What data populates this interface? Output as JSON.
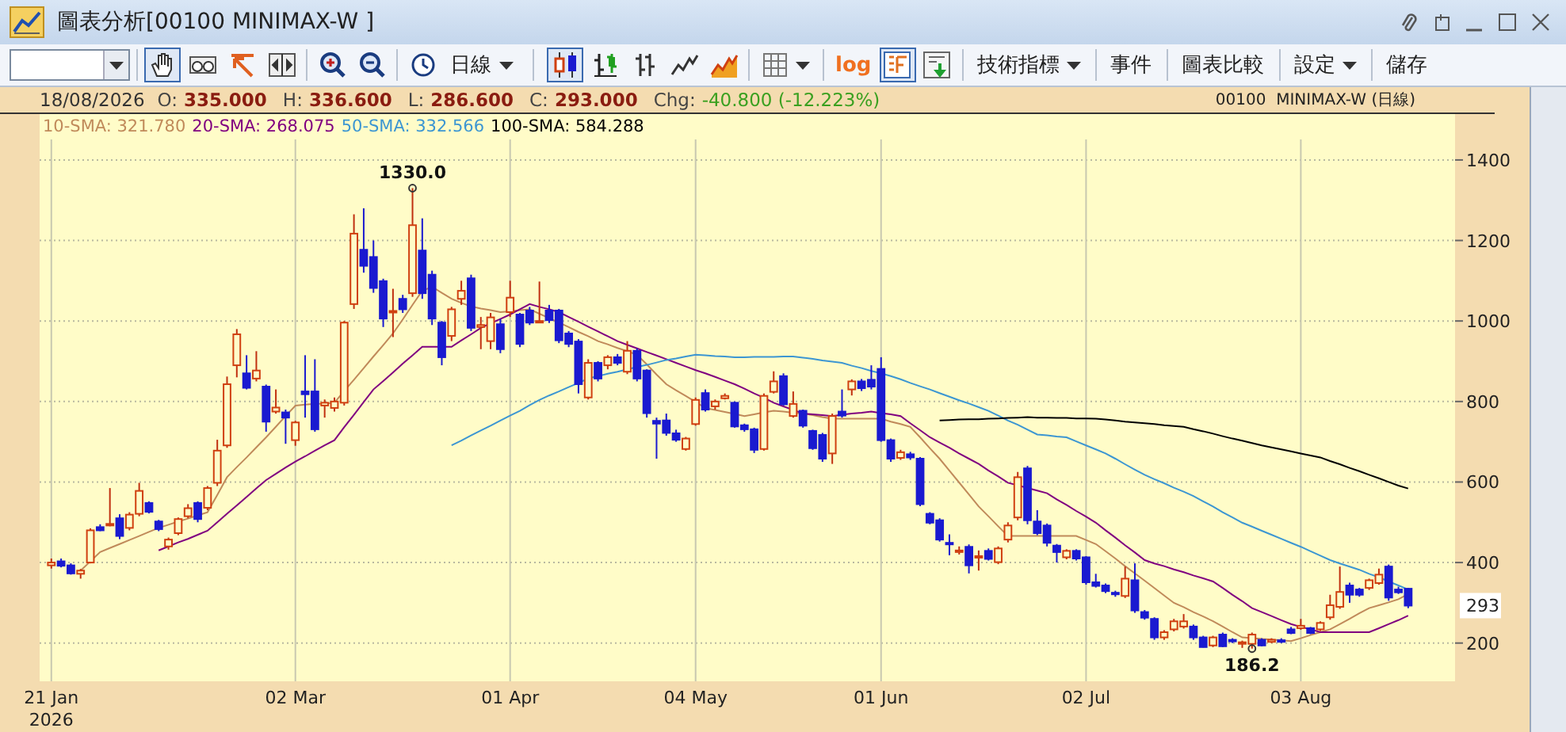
{
  "window": {
    "title": "圖表分析[00100 MINIMAX-W ]"
  },
  "toolbar": {
    "interval": "日線",
    "chart_types": [
      {
        "selected": true
      },
      {
        "selected": false
      },
      {
        "selected": false
      },
      {
        "selected": false
      },
      {
        "selected": false
      }
    ],
    "log": {
      "label": "log",
      "selected": false
    },
    "view_toggle": {
      "selected": true
    },
    "menus": [
      {
        "label": "技術指標",
        "dropdown": true
      },
      {
        "label": "事件",
        "dropdown": false
      },
      {
        "label": "圖表比較",
        "dropdown": false
      },
      {
        "label": "設定",
        "dropdown": true
      },
      {
        "label": "儲存",
        "dropdown": false
      }
    ]
  },
  "quote": {
    "date": "18/08/2026",
    "fields": [
      {
        "label": "O:",
        "value": "335.000"
      },
      {
        "label": "H:",
        "value": "336.600"
      },
      {
        "label": "L:",
        "value": "286.600"
      },
      {
        "label": "C:",
        "value": "293.000"
      }
    ],
    "change_label": "Chg:",
    "change": "-40.800 (-12.223%)",
    "instrument": "00100  MINIMAX-W (日線)"
  },
  "legend_separator": ":",
  "legend": [
    "321.780",
    "268.075",
    "332.566",
    "584.288"
  ],
  "chart": {
    "year_label": "2026",
    "last_price": "293",
    "chart_data": {
      "type": "candlestick",
      "grid": true,
      "categories": [
        "21 Jan",
        null,
        null,
        null,
        null,
        null,
        null,
        null,
        null,
        null,
        null,
        null,
        null,
        null,
        null,
        null,
        null,
        null,
        null,
        null,
        null,
        null,
        null,
        null,
        null,
        "02 Mar",
        null,
        null,
        null,
        null,
        null,
        null,
        null,
        null,
        null,
        null,
        null,
        null,
        null,
        null,
        null,
        null,
        null,
        null,
        null,
        null,
        null,
        "01 Apr",
        null,
        null,
        null,
        null,
        null,
        null,
        null,
        null,
        null,
        null,
        null,
        null,
        null,
        null,
        null,
        null,
        null,
        null,
        "04 May",
        null,
        null,
        null,
        null,
        null,
        null,
        null,
        null,
        null,
        null,
        null,
        null,
        null,
        null,
        null,
        null,
        null,
        null,
        "01 Jun",
        null,
        null,
        null,
        null,
        null,
        null,
        null,
        null,
        null,
        null,
        null,
        null,
        null,
        null,
        null,
        null,
        null,
        null,
        null,
        null,
        "02 Jul",
        null,
        null,
        null,
        null,
        null,
        null,
        null,
        null,
        null,
        null,
        null,
        null,
        null,
        null,
        null,
        null,
        null,
        null,
        null,
        null,
        null,
        "03 Aug",
        null,
        null,
        null,
        null,
        null,
        null,
        null,
        null,
        null,
        null,
        null
      ],
      "ylim": [
        105,
        1451
      ],
      "yticks": [
        200,
        400,
        600,
        800,
        1000,
        1200,
        1400
      ],
      "annotations": [
        {
          "y": 1330,
          "text": "1330.0"
        },
        {
          "y": 186.2,
          "text": "186.2"
        }
      ],
      "ohlc": [
        [
          393,
          410,
          385,
          400
        ],
        [
          403,
          410,
          388,
          392
        ],
        [
          393,
          398,
          370,
          373
        ],
        [
          372,
          384,
          360,
          380
        ],
        [
          400,
          485,
          398,
          480
        ],
        [
          488,
          495,
          478,
          480
        ],
        [
          495,
          585,
          490,
          496
        ],
        [
          510,
          520,
          458,
          466
        ],
        [
          486,
          525,
          480,
          519
        ],
        [
          521,
          598,
          515,
          578
        ],
        [
          548,
          552,
          522,
          526
        ],
        [
          502,
          506,
          478,
          483
        ],
        [
          440,
          462,
          432,
          457
        ],
        [
          473,
          512,
          468,
          508
        ],
        [
          515,
          545,
          510,
          535
        ],
        [
          548,
          552,
          500,
          508
        ],
        [
          536,
          590,
          530,
          585
        ],
        [
          598,
          705,
          590,
          678
        ],
        [
          691,
          862,
          685,
          843
        ],
        [
          890,
          980,
          860,
          967
        ],
        [
          870,
          915,
          830,
          834
        ],
        [
          857,
          925,
          850,
          877
        ],
        [
          837,
          842,
          725,
          750
        ],
        [
          775,
          830,
          770,
          785
        ],
        [
          773,
          780,
          695,
          760
        ],
        [
          704,
          752,
          690,
          748
        ],
        [
          825,
          915,
          760,
          818
        ],
        [
          825,
          905,
          725,
          731
        ],
        [
          790,
          805,
          760,
          797
        ],
        [
          784,
          810,
          775,
          800
        ],
        [
          797,
          1000,
          790,
          996
        ],
        [
          1042,
          1265,
          1030,
          1217
        ],
        [
          1177,
          1280,
          1120,
          1137
        ],
        [
          1159,
          1200,
          1070,
          1082
        ],
        [
          1099,
          1105,
          985,
          1006
        ],
        [
          1025,
          1080,
          960,
          1025
        ],
        [
          1055,
          1065,
          1020,
          1029
        ],
        [
          1069,
          1330,
          1060,
          1238
        ],
        [
          1175,
          1255,
          1055,
          1069
        ],
        [
          1115,
          1125,
          990,
          1006
        ],
        [
          996,
          1000,
          890,
          910
        ],
        [
          963,
          1035,
          950,
          1029
        ],
        [
          1055,
          1100,
          1040,
          1075
        ],
        [
          1106,
          1115,
          975,
          983
        ],
        [
          985,
          1010,
          930,
          990
        ],
        [
          950,
          1020,
          930,
          1009
        ],
        [
          992,
          1005,
          920,
          930
        ],
        [
          1022,
          1100,
          1010,
          1058
        ],
        [
          1016,
          1020,
          935,
          943
        ],
        [
          1026,
          1035,
          990,
          996
        ],
        [
          1000,
          1098,
          995,
          1000
        ],
        [
          1026,
          1040,
          995,
          1002
        ],
        [
          1026,
          1030,
          945,
          952
        ],
        [
          969,
          975,
          935,
          943
        ],
        [
          949,
          955,
          820,
          843
        ],
        [
          810,
          905,
          805,
          896
        ],
        [
          896,
          900,
          850,
          857
        ],
        [
          890,
          915,
          880,
          910
        ],
        [
          910,
          918,
          890,
          896
        ],
        [
          874,
          950,
          868,
          926
        ],
        [
          926,
          932,
          850,
          857
        ],
        [
          877,
          880,
          760,
          771
        ],
        [
          752,
          760,
          658,
          745
        ],
        [
          753,
          770,
          715,
          722
        ],
        [
          721,
          730,
          700,
          705
        ],
        [
          682,
          712,
          678,
          708
        ],
        [
          744,
          810,
          740,
          804
        ],
        [
          821,
          830,
          775,
          780
        ],
        [
          788,
          805,
          780,
          800
        ],
        [
          808,
          820,
          805,
          814
        ],
        [
          797,
          800,
          735,
          738
        ],
        [
          741,
          745,
          725,
          731
        ],
        [
          731,
          735,
          672,
          680
        ],
        [
          682,
          820,
          678,
          814
        ],
        [
          824,
          875,
          820,
          850
        ],
        [
          863,
          870,
          790,
          793
        ],
        [
          764,
          825,
          760,
          794
        ],
        [
          777,
          780,
          735,
          740
        ],
        [
          727,
          730,
          680,
          684
        ],
        [
          717,
          722,
          650,
          658
        ],
        [
          671,
          770,
          645,
          764
        ],
        [
          775,
          830,
          760,
          765
        ],
        [
          830,
          855,
          815,
          850
        ],
        [
          850,
          856,
          826,
          833
        ],
        [
          854,
          890,
          830,
          837
        ],
        [
          881,
          910,
          700,
          704
        ],
        [
          704,
          708,
          650,
          658
        ],
        [
          660,
          680,
          655,
          674
        ],
        [
          669,
          675,
          655,
          661
        ],
        [
          658,
          662,
          540,
          545
        ],
        [
          521,
          525,
          495,
          499
        ],
        [
          505,
          510,
          452,
          457
        ],
        [
          449,
          470,
          418,
          447
        ],
        [
          428,
          440,
          420,
          430
        ],
        [
          439,
          445,
          373,
          393
        ],
        [
          415,
          430,
          380,
          416
        ],
        [
          429,
          435,
          405,
          409
        ],
        [
          401,
          440,
          396,
          435
        ],
        [
          457,
          500,
          450,
          492
        ],
        [
          512,
          625,
          505,
          612
        ],
        [
          634,
          640,
          495,
          505
        ],
        [
          502,
          530,
          468,
          473
        ],
        [
          492,
          497,
          440,
          449
        ],
        [
          442,
          446,
          400,
          426
        ],
        [
          413,
          433,
          408,
          429
        ],
        [
          429,
          433,
          405,
          410
        ],
        [
          413,
          416,
          345,
          351
        ],
        [
          351,
          372,
          338,
          342
        ],
        [
          343,
          348,
          324,
          329
        ],
        [
          325,
          330,
          315,
          323
        ],
        [
          317,
          390,
          312,
          360
        ],
        [
          356,
          398,
          275,
          281
        ],
        [
          277,
          282,
          258,
          263
        ],
        [
          260,
          264,
          208,
          214
        ],
        [
          214,
          232,
          208,
          227
        ],
        [
          234,
          260,
          229,
          254
        ],
        [
          241,
          272,
          236,
          254
        ],
        [
          241,
          246,
          208,
          214
        ],
        [
          214,
          218,
          189,
          190
        ],
        [
          194,
          218,
          190,
          214
        ],
        [
          221,
          226,
          190,
          192
        ],
        [
          208,
          212,
          200,
          207
        ],
        [
          200,
          206,
          188,
          202
        ],
        [
          198,
          226,
          186.2,
          221
        ],
        [
          208,
          212,
          192,
          194
        ],
        [
          203,
          212,
          200,
          208
        ],
        [
          207,
          212,
          200,
          203
        ],
        [
          234,
          240,
          222,
          225
        ],
        [
          237,
          260,
          233,
          243
        ],
        [
          237,
          240,
          222,
          225
        ],
        [
          234,
          254,
          230,
          250
        ],
        [
          264,
          320,
          258,
          294
        ],
        [
          290,
          390,
          285,
          327
        ],
        [
          343,
          350,
          300,
          320
        ],
        [
          333,
          337,
          315,
          320
        ],
        [
          337,
          360,
          332,
          356
        ],
        [
          349,
          385,
          345,
          370
        ],
        [
          390,
          395,
          305,
          313
        ],
        [
          333,
          340,
          322,
          326
        ],
        [
          335,
          336.6,
          286.6,
          293
        ]
      ],
      "series": [
        {
          "name": "10-SMA",
          "type": "line",
          "color": "#c08a5a",
          "values": [
            null,
            null,
            null,
            380,
            403,
            426,
            436,
            446,
            456,
            466,
            476,
            486,
            494,
            502,
            509,
            517,
            525,
            568,
            612,
            637,
            661,
            686,
            711,
            737,
            764,
            790,
            792,
            794,
            795,
            797,
            826,
            854,
            883,
            912,
            940,
            969,
            1004,
            1040,
            1075,
            1085,
            1070,
            1055,
            1045,
            1036,
            1031,
            1027,
            1022,
            1024,
            1027,
            1029,
            1018,
            1007,
            996,
            985,
            973,
            962,
            950,
            942,
            933,
            925,
            916,
            892,
            867,
            843,
            828,
            814,
            799,
            784,
            779,
            774,
            769,
            764,
            768,
            773,
            777,
            775,
            772,
            770,
            766,
            761,
            757,
            757,
            757,
            757,
            757,
            757,
            750,
            744,
            737,
            711,
            684,
            658,
            628,
            599,
            569,
            539,
            515,
            490,
            466,
            466,
            466,
            466,
            466,
            466,
            466,
            466,
            456,
            446,
            428,
            410,
            391,
            373,
            355,
            337,
            318,
            300,
            289,
            277,
            266,
            254,
            241,
            227,
            214,
            212,
            210,
            209,
            207,
            205,
            212,
            220,
            227,
            234,
            247,
            260,
            274,
            287,
            294,
            301,
            309,
            322
          ]
        },
        {
          "name": "20-SMA",
          "type": "line",
          "color": "#800080",
          "values": [
            null,
            null,
            null,
            null,
            null,
            null,
            null,
            null,
            null,
            null,
            null,
            430,
            440,
            450,
            459,
            469,
            479,
            500,
            521,
            542,
            563,
            584,
            605,
            620,
            636,
            651,
            664,
            678,
            691,
            704,
            736,
            767,
            799,
            830,
            851,
            872,
            894,
            915,
            936,
            936,
            936,
            936,
            952,
            967,
            983,
            994,
            1005,
            1016,
            1029,
            1042,
            1035,
            1029,
            1022,
            1010,
            998,
            986,
            974,
            962,
            950,
            941,
            932,
            923,
            914,
            905,
            896,
            887,
            878,
            870,
            861,
            852,
            843,
            832,
            820,
            809,
            797,
            788,
            779,
            770,
            768,
            766,
            764,
            767,
            770,
            772,
            775,
            771,
            768,
            764,
            746,
            729,
            711,
            698,
            685,
            671,
            658,
            645,
            629,
            614,
            598,
            592,
            585,
            579,
            572,
            557,
            543,
            528,
            514,
            499,
            480,
            462,
            443,
            425,
            406,
            398,
            391,
            383,
            376,
            368,
            361,
            353,
            337,
            320,
            304,
            287,
            277,
            267,
            257,
            247,
            240,
            234,
            227,
            227,
            227,
            227,
            227,
            227,
            237,
            247,
            257,
            268
          ]
        },
        {
          "name": "50-SMA",
          "type": "line",
          "color": "#3c96d2",
          "values": [
            null,
            null,
            null,
            null,
            null,
            null,
            null,
            null,
            null,
            null,
            null,
            null,
            null,
            null,
            null,
            null,
            null,
            null,
            null,
            null,
            null,
            null,
            null,
            null,
            null,
            null,
            null,
            null,
            null,
            null,
            null,
            null,
            null,
            null,
            null,
            null,
            null,
            null,
            null,
            null,
            null,
            691,
            703,
            716,
            728,
            740,
            753,
            765,
            777,
            791,
            804,
            815,
            825,
            836,
            846,
            857,
            863,
            869,
            874,
            880,
            886,
            891,
            897,
            903,
            907,
            912,
            916,
            915,
            913,
            912,
            910,
            910,
            911,
            911,
            911,
            912,
            912,
            909,
            906,
            902,
            899,
            896,
            889,
            883,
            876,
            870,
            863,
            855,
            846,
            838,
            830,
            821,
            812,
            803,
            795,
            786,
            777,
            765,
            753,
            742,
            730,
            718,
            716,
            713,
            711,
            701,
            691,
            681,
            671,
            658,
            644,
            631,
            618,
            607,
            597,
            586,
            576,
            565,
            552,
            539,
            525,
            512,
            499,
            489,
            479,
            469,
            459,
            449,
            439,
            428,
            417,
            406,
            398,
            390,
            382,
            372,
            363,
            353,
            343,
            333
          ]
        },
        {
          "name": "100-SMA",
          "type": "line",
          "color": "#000000",
          "values": [
            null,
            null,
            null,
            null,
            null,
            null,
            null,
            null,
            null,
            null,
            null,
            null,
            null,
            null,
            null,
            null,
            null,
            null,
            null,
            null,
            null,
            null,
            null,
            null,
            null,
            null,
            null,
            null,
            null,
            null,
            null,
            null,
            null,
            null,
            null,
            null,
            null,
            null,
            null,
            null,
            null,
            null,
            null,
            null,
            null,
            null,
            null,
            null,
            null,
            null,
            null,
            null,
            null,
            null,
            null,
            null,
            null,
            null,
            null,
            null,
            null,
            null,
            null,
            null,
            null,
            null,
            null,
            null,
            null,
            null,
            null,
            null,
            null,
            null,
            null,
            null,
            null,
            null,
            null,
            null,
            null,
            null,
            null,
            null,
            null,
            null,
            null,
            null,
            null,
            null,
            null,
            753,
            754,
            755,
            756,
            756,
            757,
            758,
            759,
            760,
            761,
            760,
            760,
            759,
            759,
            758,
            758,
            757,
            755,
            753,
            750,
            748,
            746,
            744,
            741,
            739,
            737,
            731,
            726,
            720,
            714,
            708,
            703,
            697,
            691,
            686,
            681,
            676,
            671,
            666,
            661,
            652,
            644,
            635,
            627,
            618,
            609,
            600,
            591,
            584
          ]
        }
      ]
    }
  }
}
